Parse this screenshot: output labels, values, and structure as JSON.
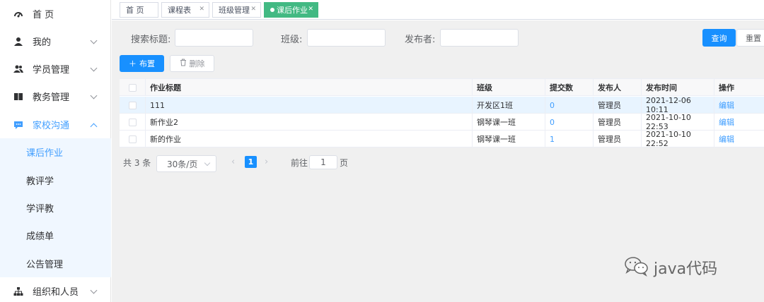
{
  "sidebar": {
    "items": [
      {
        "label": "首 页",
        "icon": "dashboard-icon"
      },
      {
        "label": "我的",
        "icon": "user-icon"
      },
      {
        "label": "学员管理",
        "icon": "users-icon"
      },
      {
        "label": "教务管理",
        "icon": "book-icon"
      },
      {
        "label": "家校沟通",
        "icon": "chat-icon"
      },
      {
        "label": "组织和人员",
        "icon": "org-chart-icon"
      }
    ],
    "submenu": [
      "课后作业",
      "教评学",
      "学评教",
      "成绩单",
      "公告管理"
    ]
  },
  "tabs": [
    {
      "label": "首 页"
    },
    {
      "label": "课程表"
    },
    {
      "label": "班级管理"
    },
    {
      "label": "课后作业"
    }
  ],
  "search": {
    "title_label": "搜索标题:",
    "class_label": "班级:",
    "publisher_label": "发布者:",
    "query_button": "查询",
    "reset_button": "重置"
  },
  "toolbar": {
    "add_label": "布置",
    "delete_label": "删除"
  },
  "table": {
    "headers": [
      "作业标题",
      "班级",
      "提交数",
      "发布人",
      "发布时间",
      "操作"
    ],
    "rows": [
      {
        "title": "111",
        "class": "开发区1班",
        "count": "0",
        "publisher": "管理员",
        "time": "2021-12-06 10:11",
        "action": "编辑"
      },
      {
        "title": "新作业2",
        "class": "钢琴课一班",
        "count": "0",
        "publisher": "管理员",
        "time": "2021-10-10 22:53",
        "action": "编辑"
      },
      {
        "title": "新的作业",
        "class": "钢琴课一班",
        "count": "1",
        "publisher": "管理员",
        "time": "2021-10-10 22:52",
        "action": "编辑"
      }
    ]
  },
  "pagination": {
    "total": "共 3 条",
    "page_size": "30条/页",
    "current_page": "1",
    "goto_label": "前往",
    "goto_value": "1",
    "page_suffix": "页"
  },
  "watermark": {
    "text": "java代码"
  },
  "colors": {
    "primary": "#1890ff",
    "active_tab": "#42b983",
    "link": "#409eff"
  }
}
